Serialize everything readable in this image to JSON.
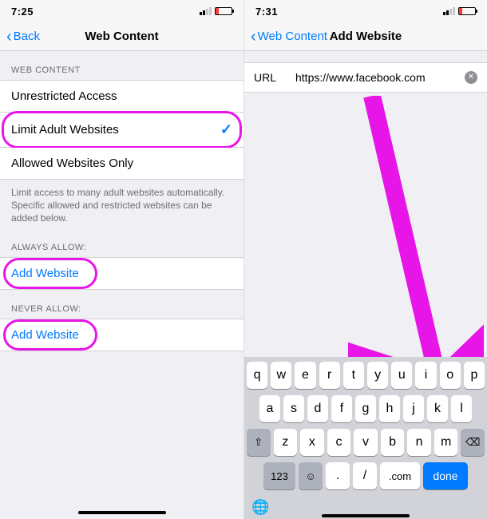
{
  "left": {
    "status": {
      "time": "7:25"
    },
    "nav": {
      "back": "Back",
      "title": "Web Content"
    },
    "section1": {
      "header": "WEB CONTENT"
    },
    "options": {
      "unrestricted": "Unrestricted Access",
      "limit": "Limit Adult Websites",
      "allowed": "Allowed Websites Only"
    },
    "footer": "Limit access to many adult websites automatically. Specific allowed and restricted websites can be added below.",
    "always": {
      "header": "ALWAYS ALLOW:",
      "add": "Add Website"
    },
    "never": {
      "header": "NEVER ALLOW:",
      "add": "Add Website"
    }
  },
  "right": {
    "status": {
      "time": "7:31"
    },
    "nav": {
      "back": "Web Content",
      "title": "Add Website"
    },
    "url": {
      "label": "URL",
      "value": "https://www.facebook.com"
    },
    "keyboard": {
      "r1": [
        "q",
        "w",
        "e",
        "r",
        "t",
        "y",
        "u",
        "i",
        "o",
        "p"
      ],
      "r2": [
        "a",
        "s",
        "d",
        "f",
        "g",
        "h",
        "j",
        "k",
        "l"
      ],
      "r3": [
        "z",
        "x",
        "c",
        "v",
        "b",
        "n",
        "m"
      ],
      "r4": {
        "num": "123",
        "dot": ".",
        "slash": "/",
        "com": ".com",
        "done": "done"
      }
    }
  }
}
